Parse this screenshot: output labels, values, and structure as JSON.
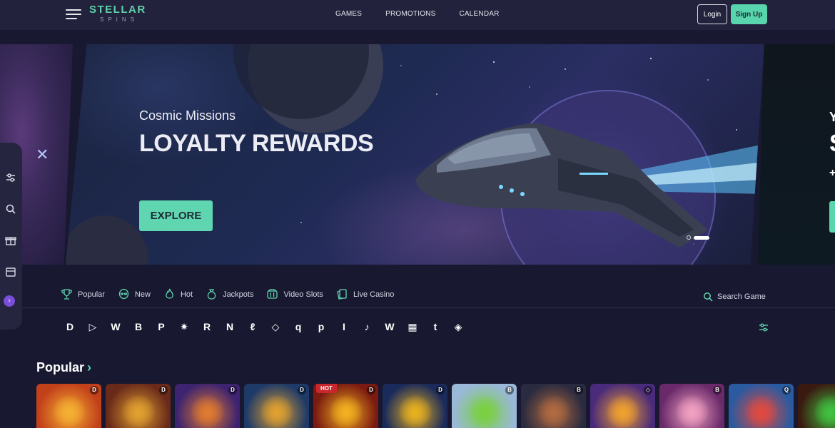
{
  "header": {
    "logo_main": "STELLAR",
    "logo_sub": "SPINS",
    "nav": [
      "GAMES",
      "PROMOTIONS",
      "CALENDAR"
    ],
    "login_label": "Login",
    "signup_label": "Sign Up"
  },
  "banner": {
    "subtitle": "Cosmic Missions",
    "title": "LOYALTY REWARDS",
    "cta_label": "EXPLORE",
    "slides_count": 2,
    "active_slide": 2,
    "peek_right_letters": [
      "Y",
      "S",
      "+"
    ]
  },
  "side_rail": {
    "icons": [
      "sliders-icon",
      "search-icon",
      "gift-icon",
      "calendar-icon"
    ],
    "expand_label": "›"
  },
  "categories": [
    {
      "label": "Popular",
      "icon": "trophy-icon"
    },
    {
      "label": "New",
      "icon": "alien-icon"
    },
    {
      "label": "Hot",
      "icon": "flame-icon"
    },
    {
      "label": "Jackpots",
      "icon": "money-bag-icon"
    },
    {
      "label": "Video Slots",
      "icon": "slot-machine-icon"
    },
    {
      "label": "Live Casino",
      "icon": "cards-icon"
    }
  ],
  "search_label": "Search Game",
  "providers": [
    "D",
    "▷",
    "W",
    "B",
    "P",
    "✷",
    "R",
    "N",
    "ℓ",
    "◇",
    "q",
    "p",
    "I",
    "♪",
    "W",
    "▦",
    "t",
    "◈"
  ],
  "popular": {
    "title": "Popular",
    "chevron": "›",
    "games": [
      {
        "badge": "D",
        "hot": "",
        "bg": "#c2401a",
        "accent": "#f5b033"
      },
      {
        "badge": "D",
        "hot": "",
        "bg": "#6a2a1a",
        "accent": "#e0a030"
      },
      {
        "badge": "D",
        "hot": "",
        "bg": "#3d2370",
        "accent": "#e07a30"
      },
      {
        "badge": "D",
        "hot": "",
        "bg": "#1e3a68",
        "accent": "#e0a030"
      },
      {
        "badge": "D",
        "hot": "HOT",
        "bg": "#7a1a10",
        "accent": "#f2b020"
      },
      {
        "badge": "D",
        "hot": "",
        "bg": "#1a2a5a",
        "accent": "#e8b020"
      },
      {
        "badge": "B",
        "hot": "",
        "bg": "#9ab8d8",
        "accent": "#7ad040"
      },
      {
        "badge": "B",
        "hot": "",
        "bg": "#2a2a40",
        "accent": "#b06a40"
      },
      {
        "badge": "◇",
        "hot": "",
        "bg": "#4a2a7a",
        "accent": "#f0a030"
      },
      {
        "badge": "B",
        "hot": "",
        "bg": "#6a2a6a",
        "accent": "#f0a0c0"
      },
      {
        "badge": "Q",
        "hot": "",
        "bg": "#2a5aa0",
        "accent": "#e04a40"
      },
      {
        "badge": "",
        "hot": "",
        "bg": "#3a1a10",
        "accent": "#40c040"
      }
    ]
  },
  "colors": {
    "accent": "#58d5ad",
    "background": "#181830",
    "header": "#22223c",
    "hot_badge": "#c8272c",
    "side_dot": "#7a4ed8"
  }
}
